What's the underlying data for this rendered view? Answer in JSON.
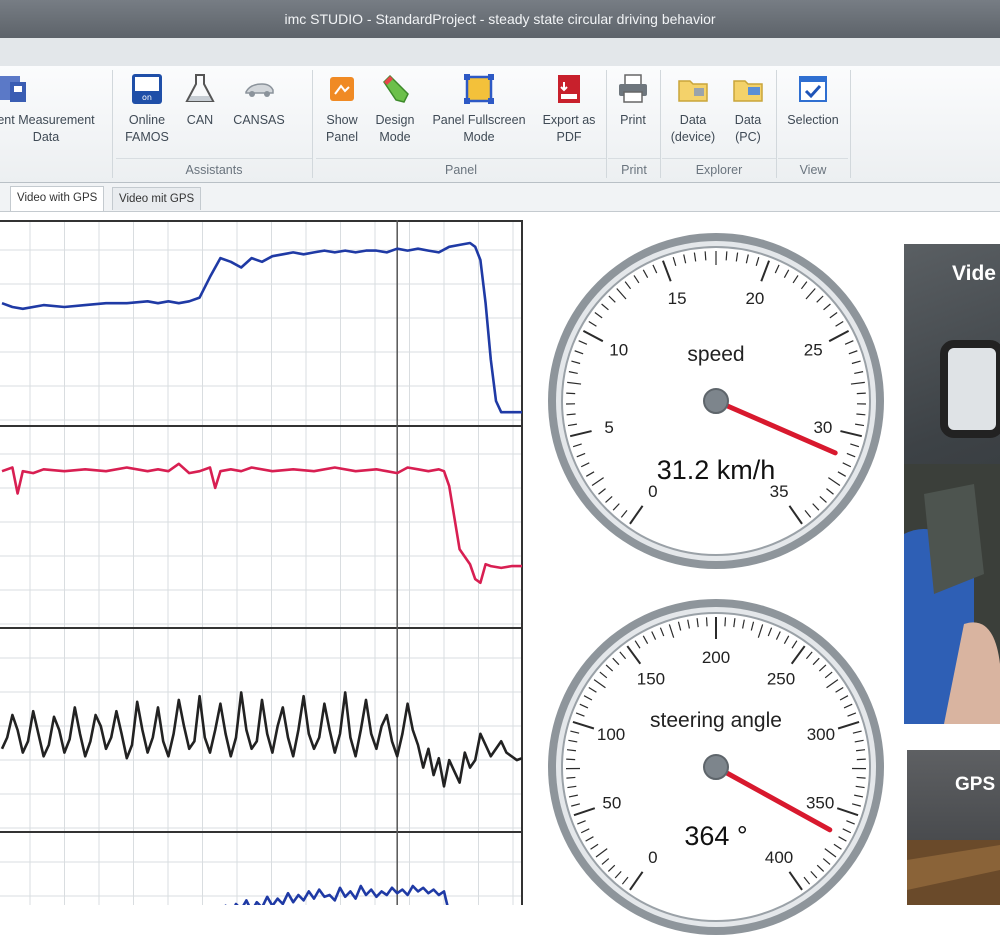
{
  "window": {
    "title": "imc STUDIO - StandardProject - steady state circular driving behavior"
  },
  "ribbon": {
    "buttons": [
      {
        "id": "current-measurement",
        "l1": "ent Measurement",
        "l2": "Data"
      },
      {
        "id": "online-famos",
        "l1": "Online",
        "l2": "FAMOS"
      },
      {
        "id": "can",
        "l1": "CAN",
        "l2": ""
      },
      {
        "id": "cansas",
        "l1": "CANSAS",
        "l2": ""
      },
      {
        "id": "show-panel",
        "l1": "Show",
        "l2": "Panel"
      },
      {
        "id": "design-mode",
        "l1": "Design",
        "l2": "Mode"
      },
      {
        "id": "panel-fullscreen",
        "l1": "Panel Fullscreen",
        "l2": "Mode"
      },
      {
        "id": "export-pdf",
        "l1": "Export as",
        "l2": "PDF"
      },
      {
        "id": "print",
        "l1": "Print",
        "l2": ""
      },
      {
        "id": "data-device",
        "l1": "Data",
        "l2": "(device)"
      },
      {
        "id": "data-pc",
        "l1": "Data",
        "l2": "(PC)"
      },
      {
        "id": "selection",
        "l1": "Selection",
        "l2": ""
      }
    ],
    "groups": [
      "Assistants",
      "Panel",
      "Print",
      "Explorer",
      "View"
    ],
    "icon_names": [
      "measurement-data-icon",
      "famos-icon",
      "can-flask-icon",
      "cansas-icon",
      "show-panel-icon",
      "design-pencil-icon",
      "fullscreen-icon",
      "pdf-icon",
      "printer-icon",
      "folder-device-icon",
      "folder-pc-icon",
      "selection-check-icon"
    ]
  },
  "doc_tabs": [
    "Video with GPS",
    "Video mit GPS"
  ],
  "gauges": {
    "speed": {
      "label": "speed",
      "readout": "31.2 km/h",
      "value": 31.2,
      "min": 0,
      "max": 35,
      "major": [
        0,
        5,
        10,
        15,
        20,
        25,
        30,
        35
      ],
      "ticks": [
        "0",
        "5",
        "10",
        "15",
        "20",
        "25",
        "30",
        "35"
      ]
    },
    "steering": {
      "label": "steering angle",
      "readout": "364 °",
      "value": 364,
      "min": 0,
      "max": 400,
      "major": [
        0,
        50,
        100,
        150,
        200,
        250,
        300,
        350,
        400
      ],
      "ticks": [
        "0",
        "50",
        "100",
        "150",
        "200",
        "250",
        "300",
        "350",
        "400"
      ]
    }
  },
  "video": {
    "label": "Vide"
  },
  "gps": {
    "label": "GPS"
  },
  "colors": {
    "blue": "#1f3aa5",
    "red": "#d81f52",
    "black": "#222222",
    "needle": "#d8192e",
    "grid": "#d9dde0",
    "axis": "#333333"
  },
  "chart_data": {
    "type": "line",
    "x_range": [
      0,
      100
    ],
    "cursor_x": 76,
    "series": [
      {
        "color": "#1f3aa5",
        "panel": 0,
        "y_range": [
          0,
          100
        ],
        "x": [
          0,
          2,
          4,
          8,
          12,
          16,
          20,
          24,
          28,
          30,
          32,
          34,
          36,
          38,
          40,
          42,
          44,
          46,
          48,
          50,
          52,
          54,
          56,
          58,
          60,
          62,
          64,
          66,
          68,
          70,
          72,
          74,
          76,
          78,
          80,
          82,
          84,
          86,
          88,
          90,
          91,
          92,
          93,
          94,
          95,
          96,
          97,
          98,
          99,
          100
        ],
        "y": [
          60,
          58,
          57,
          59,
          58,
          59,
          60,
          60,
          61,
          60,
          61,
          60,
          61,
          63,
          74,
          84,
          82,
          79,
          84,
          82,
          85,
          86,
          87,
          86,
          87,
          88,
          87,
          88,
          87,
          88,
          88,
          87,
          89,
          88,
          89,
          88,
          87,
          90,
          91,
          92,
          90,
          83,
          60,
          30,
          8,
          2,
          2,
          2,
          2,
          2
        ]
      },
      {
        "color": "#d81f52",
        "panel": 1,
        "y_range": [
          0,
          100
        ],
        "x": [
          0,
          2,
          3,
          4,
          6,
          8,
          12,
          16,
          20,
          24,
          28,
          30,
          32,
          34,
          36,
          38,
          40,
          41,
          42,
          44,
          46,
          48,
          52,
          56,
          60,
          64,
          68,
          72,
          74,
          76,
          78,
          80,
          82,
          84,
          85,
          86,
          87,
          88,
          89,
          90,
          91,
          92,
          93,
          94,
          96,
          98,
          100
        ],
        "y": [
          80,
          82,
          68,
          80,
          79,
          81,
          80,
          81,
          80,
          82,
          80,
          81,
          80,
          84,
          79,
          80,
          82,
          71,
          80,
          81,
          80,
          82,
          80,
          81,
          80,
          82,
          80,
          81,
          80,
          79,
          82,
          81,
          80,
          81,
          80,
          72,
          55,
          38,
          34,
          30,
          22,
          20,
          30,
          29,
          28,
          29,
          29
        ]
      },
      {
        "color": "#222222",
        "panel": 2,
        "y_range": [
          0,
          100
        ],
        "x": [
          0,
          1,
          2,
          3,
          4,
          5,
          6,
          7,
          8,
          9,
          10,
          11,
          12,
          13,
          14,
          15,
          16,
          17,
          18,
          19,
          20,
          21,
          22,
          23,
          24,
          25,
          26,
          27,
          28,
          29,
          30,
          31,
          32,
          33,
          34,
          35,
          36,
          37,
          38,
          39,
          40,
          41,
          42,
          43,
          44,
          45,
          46,
          47,
          48,
          49,
          50,
          51,
          52,
          53,
          54,
          55,
          56,
          57,
          58,
          59,
          60,
          61,
          62,
          63,
          64,
          65,
          66,
          67,
          68,
          69,
          70,
          71,
          72,
          73,
          74,
          75,
          76,
          77,
          78,
          79,
          80,
          81,
          82,
          83,
          84,
          85,
          86,
          87,
          88,
          89,
          90,
          91,
          92,
          93,
          94,
          95,
          96,
          97,
          98,
          99,
          100
        ],
        "y": [
          40,
          46,
          58,
          50,
          38,
          44,
          60,
          48,
          36,
          42,
          57,
          50,
          38,
          45,
          62,
          48,
          36,
          44,
          58,
          52,
          40,
          46,
          60,
          48,
          35,
          42,
          65,
          50,
          38,
          46,
          62,
          44,
          36,
          48,
          66,
          52,
          40,
          44,
          68,
          46,
          38,
          50,
          64,
          48,
          36,
          46,
          70,
          50,
          40,
          44,
          66,
          48,
          38,
          52,
          62,
          46,
          36,
          50,
          68,
          48,
          40,
          46,
          64,
          50,
          38,
          48,
          70,
          46,
          36,
          50,
          66,
          48,
          40,
          52,
          58,
          44,
          36,
          48,
          64,
          50,
          42,
          30,
          40,
          26,
          35,
          20,
          34,
          28,
          22,
          38,
          30,
          34,
          48,
          42,
          36,
          40,
          44,
          38,
          36,
          34,
          35
        ]
      },
      {
        "color": "#1f3aa5",
        "panel": 3,
        "y_range": [
          0,
          100
        ],
        "x": [
          40,
          42,
          43,
          44,
          45,
          46,
          47,
          48,
          49,
          50,
          51,
          52,
          53,
          54,
          55,
          56,
          57,
          58,
          59,
          60,
          61,
          62,
          63,
          64,
          65,
          66,
          67,
          68,
          69,
          70,
          71,
          72,
          73,
          74,
          75,
          76,
          77,
          78,
          79,
          80,
          81,
          82,
          83,
          84,
          85,
          86,
          87
        ],
        "y": [
          2,
          10,
          18,
          8,
          20,
          14,
          24,
          12,
          22,
          16,
          28,
          18,
          26,
          20,
          32,
          22,
          30,
          24,
          34,
          26,
          36,
          28,
          30,
          24,
          38,
          28,
          34,
          26,
          40,
          30,
          36,
          28,
          34,
          30,
          38,
          32,
          36,
          30,
          40,
          34,
          38,
          32,
          36,
          30,
          34,
          10,
          2
        ]
      }
    ]
  }
}
